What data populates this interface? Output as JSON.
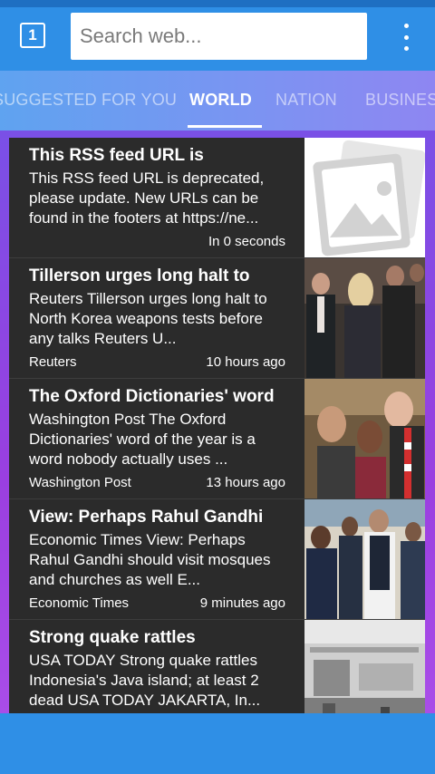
{
  "toolbar": {
    "tab_count": "1",
    "search_placeholder": "Search web..."
  },
  "tabs": [
    {
      "label": "SUGGESTED FOR YOU",
      "active": false
    },
    {
      "label": "WORLD",
      "active": true
    },
    {
      "label": "NATION",
      "active": false
    },
    {
      "label": "BUSINESS",
      "active": false
    }
  ],
  "articles": [
    {
      "title": "This RSS feed URL is",
      "description": "This RSS feed URL is deprecated, please update. New URLs can be found in the footers at https://ne...",
      "source": "",
      "time": "In 0 seconds",
      "thumbnail": "placeholder-image-icon"
    },
    {
      "title": "Tillerson urges long halt to",
      "description": "Reuters Tillerson urges long halt to North Korea weapons tests before any talks Reuters U...",
      "source": "Reuters",
      "time": "10 hours ago",
      "thumbnail": "photo-officials-meeting"
    },
    {
      "title": "The Oxford Dictionaries' word",
      "description": "Washington Post The Oxford Dictionaries' word of the year is a word nobody actually uses ...",
      "source": "Washington Post",
      "time": "13 hours ago",
      "thumbnail": "photo-selfie-crowd"
    },
    {
      "title": "View: Perhaps Rahul Gandhi",
      "description": "Economic Times View: Perhaps Rahul Gandhi should visit mosques and churches as well E...",
      "source": "Economic Times",
      "time": "9 minutes ago",
      "thumbnail": "photo-politicians-standing"
    },
    {
      "title": "Strong quake rattles",
      "description": "USA TODAY Strong quake rattles Indonesia's Java island; at least 2 dead USA TODAY JAKARTA, In...",
      "source": "",
      "time": "",
      "thumbnail": "photo-damaged-building"
    }
  ]
}
